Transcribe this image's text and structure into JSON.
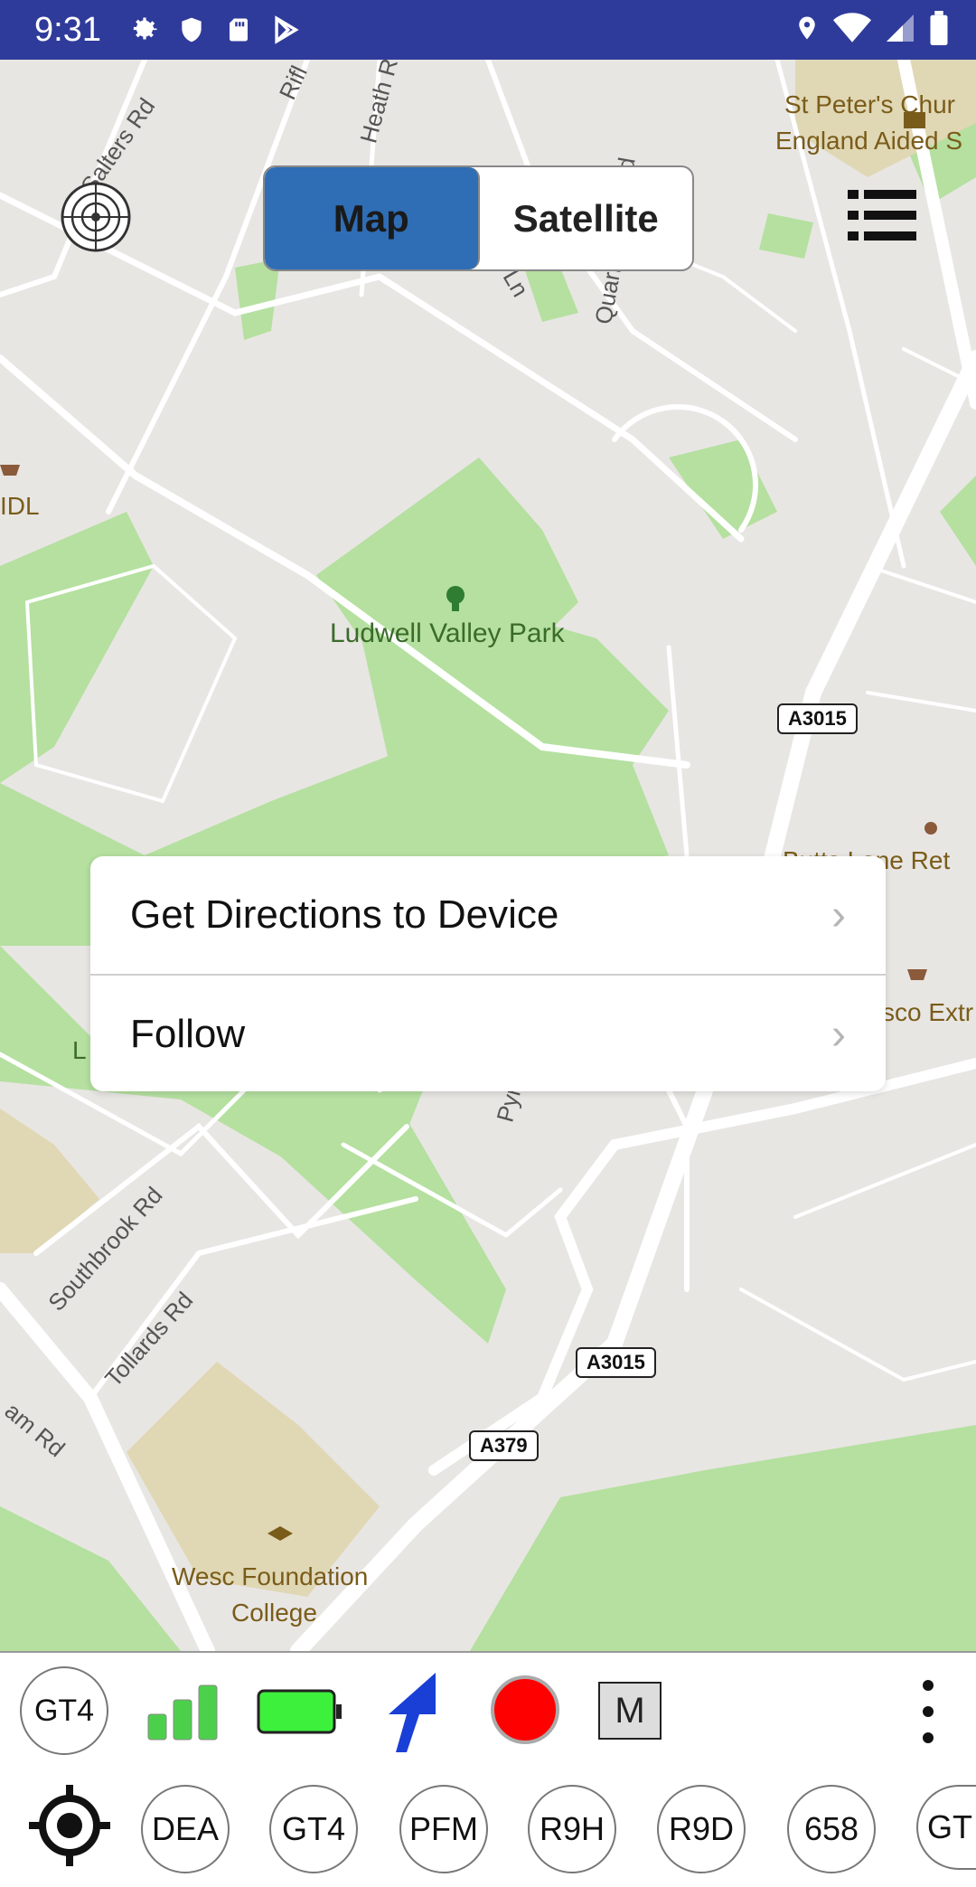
{
  "status_bar": {
    "time": "9:31",
    "left_icons": [
      "settings-icon",
      "shield-icon",
      "sd-card-icon",
      "play-store-icon"
    ],
    "right_icons": [
      "location-icon",
      "wifi-icon",
      "signal-icon",
      "battery-icon"
    ]
  },
  "map_toggle": {
    "map_label": "Map",
    "satellite_label": "Satellite",
    "selected": "Map"
  },
  "map_labels": {
    "park": "Ludwell Valley Park",
    "church_1": "St Peter's Chur",
    "church_2": "England Aided S",
    "aldi": "IDL",
    "college_1": "Wesc Foundation",
    "college_2": "College",
    "butts_lane": "Butts Lane Ret",
    "tesco": "sco Extr",
    "salters_rd": "Salters Rd",
    "heath_rd": "Heath R",
    "rifle": "Rifl",
    "quarry": "Quarr",
    "southbrook_rd": "Southbrook Rd",
    "tollards_rd": "Tollards Rd",
    "am_rd": "am Rd",
    "pyr": "Pyr",
    "ln": "Ln",
    "d": "d",
    "l": "L",
    "shield_a3015_1": "A3015",
    "shield_a3015_2": "A3015",
    "shield_a379": "A379"
  },
  "popup": {
    "items": [
      {
        "label": "Get Directions to Device"
      },
      {
        "label": "Follow"
      }
    ]
  },
  "device_toolbar": {
    "device": "GT4",
    "record_label": "",
    "mode_label": "M",
    "colors": {
      "battery": "#3cf03c",
      "signal": "#4cd04c",
      "arrow": "#1a3fd6",
      "record": "#ff0000"
    }
  },
  "device_list": [
    "DEA",
    "GT4",
    "PFM",
    "R9H",
    "R9D",
    "658",
    "GT"
  ],
  "colors": {
    "status_bar": "#2f3b9a",
    "toggle_active": "#2f6db5",
    "park_green": "#b5e0a0",
    "road": "#ffffff"
  }
}
